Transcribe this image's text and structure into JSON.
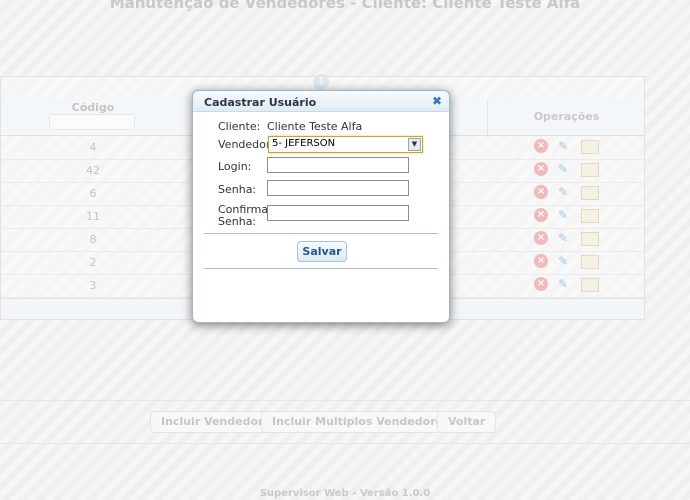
{
  "page": {
    "title": "Manutenção de Vendedores - Cliente: Cliente Teste Alfa",
    "footer": "Supervisor Web - Versão 1.0.0"
  },
  "grid": {
    "columns": {
      "codigo": "Código",
      "operacoes": "Operações"
    },
    "rows": [
      "4",
      "42",
      "6",
      "11",
      "8",
      "2",
      "3"
    ]
  },
  "bottom_buttons": {
    "incluir": "Incluir Vendedor",
    "multiplos": "Incluir Multiplos Vendedores",
    "voltar": "Voltar"
  },
  "dialog": {
    "title": "Cadastrar Usuário",
    "close_icon": "close-icon",
    "cliente_label": "Cliente:",
    "cliente_value": "Cliente Teste Alfa",
    "vendedor_label": "Vendedor",
    "vendedor_selected": "5- JEFERSON",
    "login_label": "Login:",
    "senha_label": "Senha:",
    "confirmar_label_1": "Confirmar",
    "confirmar_label_2": "Senha:",
    "login_value": "",
    "senha_value": "",
    "confirmar_value": "",
    "save_label": "Salvar"
  },
  "colors": {
    "accent": "#3a79b6",
    "dialog_border": "#9fb6c8",
    "select_border": "#c8a23a"
  }
}
